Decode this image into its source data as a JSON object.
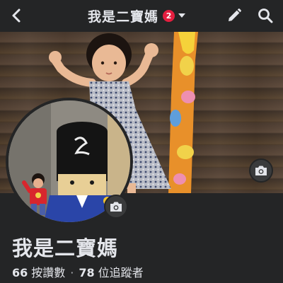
{
  "header": {
    "title": "我是二寶媽",
    "notification_count": "2",
    "back_icon": "chevron-left-icon",
    "edit_icon": "pencil-icon",
    "search_icon": "search-icon"
  },
  "profile": {
    "name": "我是二寶媽",
    "likes_count": "66",
    "likes_label": "按讚數",
    "separator": "·",
    "followers_count": "78",
    "followers_label": "位追蹤者"
  },
  "colors": {
    "background": "#242526",
    "text": "#e4e6eb",
    "badge": "#e41e3f",
    "icon_button": "#3a3b3c"
  }
}
